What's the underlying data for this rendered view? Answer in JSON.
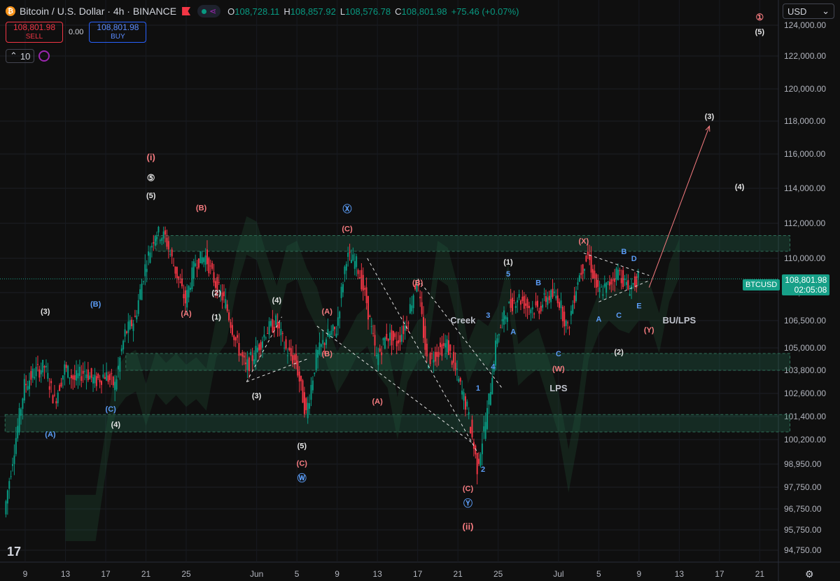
{
  "header": {
    "title": "Bitcoin / U.S. Dollar · 4h · BINANCE",
    "ohlc": [
      {
        "k": "O",
        "v": "108,728.11"
      },
      {
        "k": "H",
        "v": "108,857.92"
      },
      {
        "k": "L",
        "v": "108,576.78"
      },
      {
        "k": "C",
        "v": "108,801.98"
      }
    ],
    "change": "+75.46 (+0.07%)"
  },
  "trade": {
    "sell_price": "108,801.98",
    "sell_label": "SELL",
    "spread": "0.00",
    "buy_price": "108,801.98",
    "buy_label": "BUY"
  },
  "indicator": {
    "count": "10"
  },
  "currency": "USD",
  "price_tag": {
    "symbol": "BTCUSD",
    "price": "108,801.98",
    "countdown": "02:05:08"
  },
  "colors": {
    "up": "#089981",
    "down": "#f23645",
    "blue_label": "#5b9cf6",
    "red_label": "#f77c80",
    "accent": "#2962ff"
  },
  "chart_data": {
    "type": "candlestick",
    "price_axis": {
      "ticks": [
        124000,
        122000,
        120000,
        118000,
        116000,
        114000,
        112000,
        110000,
        108000,
        106500,
        105000,
        103800,
        102600,
        101400,
        100200,
        98950,
        97750,
        96750,
        95750,
        94750
      ],
      "tick_labels": [
        "124,000.00",
        "122,000.00",
        "120,000.00",
        "118,000.00",
        "116,000.00",
        "114,000.00",
        "112,000.00",
        "110,000.00",
        "108,000.00",
        "106,500.00",
        "105,000.00",
        "103,800.00",
        "102,600.00",
        "101,400.00",
        "100,200.00",
        "98,950.00",
        "97,750.00",
        "96,750.00",
        "95,750.00",
        "94,750.00"
      ]
    },
    "time_axis": {
      "ticks": [
        "May 9",
        "May 13",
        "May 17",
        "May 21",
        "May 25",
        "Jun",
        "Jun 5",
        "Jun 9",
        "Jun 13",
        "Jun 17",
        "Jun 21",
        "Jun 25",
        "Jul",
        "Jul 5",
        "Jul 9",
        "Jul 13",
        "Jul 17",
        "Jul 21"
      ],
      "tick_labels": [
        "9",
        "13",
        "17",
        "21",
        "25",
        "Jun",
        "5",
        "9",
        "13",
        "17",
        "21",
        "25",
        "Jul",
        "5",
        "9",
        "13",
        "17",
        "21"
      ]
    },
    "price_path": [
      {
        "t": "May 7",
        "p": 96500
      },
      {
        "t": "May 8",
        "p": 99800
      },
      {
        "t": "May 9",
        "p": 103000
      },
      {
        "t": "May 10",
        "p": 103700
      },
      {
        "t": "May 11",
        "p": 104000
      },
      {
        "t": "May 12",
        "p": 102200
      },
      {
        "t": "May 13",
        "p": 103900
      },
      {
        "t": "May 14",
        "p": 103300
      },
      {
        "t": "May 15",
        "p": 103800
      },
      {
        "t": "May 16",
        "p": 103200
      },
      {
        "t": "May 17",
        "p": 103600
      },
      {
        "t": "May 18",
        "p": 103000
      },
      {
        "t": "May 19",
        "p": 105800
      },
      {
        "t": "May 20",
        "p": 106600
      },
      {
        "t": "May 21",
        "p": 109500
      },
      {
        "t": "May 22",
        "p": 111500
      },
      {
        "t": "May 23",
        "p": 111200
      },
      {
        "t": "May 24",
        "p": 109300
      },
      {
        "t": "May 25",
        "p": 107500
      },
      {
        "t": "May 26",
        "p": 109800
      },
      {
        "t": "May 27",
        "p": 110100
      },
      {
        "t": "May 28",
        "p": 108500
      },
      {
        "t": "May 29",
        "p": 107400
      },
      {
        "t": "May 30",
        "p": 105400
      },
      {
        "t": "May 31",
        "p": 103900
      },
      {
        "t": "Jun 1",
        "p": 104800
      },
      {
        "t": "Jun 2",
        "p": 105900
      },
      {
        "t": "Jun 3",
        "p": 106400
      },
      {
        "t": "Jun 4",
        "p": 104900
      },
      {
        "t": "Jun 5",
        "p": 104200
      },
      {
        "t": "Jun 6",
        "p": 101500
      },
      {
        "t": "Jun 7",
        "p": 104500
      },
      {
        "t": "Jun 8",
        "p": 105600
      },
      {
        "t": "Jun 9",
        "p": 106000
      },
      {
        "t": "Jun 10",
        "p": 110100
      },
      {
        "t": "Jun 11",
        "p": 109700
      },
      {
        "t": "Jun 12",
        "p": 107500
      },
      {
        "t": "Jun 13",
        "p": 104400
      },
      {
        "t": "Jun 14",
        "p": 105700
      },
      {
        "t": "Jun 15",
        "p": 105300
      },
      {
        "t": "Jun 16",
        "p": 106400
      },
      {
        "t": "Jun 17",
        "p": 108800
      },
      {
        "t": "Jun 18",
        "p": 104300
      },
      {
        "t": "Jun 19",
        "p": 104800
      },
      {
        "t": "Jun 20",
        "p": 105200
      },
      {
        "t": "Jun 21",
        "p": 103500
      },
      {
        "t": "Jun 22",
        "p": 101800
      },
      {
        "t": "Jun 23",
        "p": 98800
      },
      {
        "t": "Jun 24",
        "p": 101600
      },
      {
        "t": "Jun 25",
        "p": 105700
      },
      {
        "t": "Jun 26",
        "p": 107100
      },
      {
        "t": "Jun 27",
        "p": 107800
      },
      {
        "t": "Jun 28",
        "p": 107300
      },
      {
        "t": "Jun 29",
        "p": 107100
      },
      {
        "t": "Jun 30",
        "p": 107800
      },
      {
        "t": "Jul 1",
        "p": 107800
      },
      {
        "t": "Jul 2",
        "p": 106000
      },
      {
        "t": "Jul 3",
        "p": 108800
      },
      {
        "t": "Jul 4",
        "p": 110200
      },
      {
        "t": "Jul 5",
        "p": 108000
      },
      {
        "t": "Jul 6",
        "p": 108400
      },
      {
        "t": "Jul 7",
        "p": 109300
      },
      {
        "t": "Jul 8",
        "p": 108200
      },
      {
        "t": "Jul 9",
        "p": 108800
      }
    ],
    "zones": [
      {
        "from": "May 22",
        "to": "Jul 24",
        "low": 110400,
        "high": 111300
      },
      {
        "from": "May 19",
        "to": "Jul 24",
        "low": 103800,
        "high": 104700
      },
      {
        "from": "May 7",
        "to": "Jul 24",
        "low": 100600,
        "high": 101500
      }
    ],
    "wave_labels": [
      {
        "text": "(i)",
        "t": "May 21.5",
        "p": 115800,
        "color": "red"
      },
      {
        "text": "⑤",
        "t": "May 21.5",
        "p": 114600,
        "color": "white"
      },
      {
        "text": "(5)",
        "t": "May 21.5",
        "p": 113600,
        "color": "white"
      },
      {
        "text": "(B)",
        "t": "May 26.5",
        "p": 112900,
        "color": "red"
      },
      {
        "text": "(2)",
        "t": "May 28",
        "p": 108000,
        "color": "white"
      },
      {
        "text": "(A)",
        "t": "May 25",
        "p": 106900,
        "color": "red"
      },
      {
        "text": "(1)",
        "t": "May 28",
        "p": 106700,
        "color": "white"
      },
      {
        "text": "(B)",
        "t": "May 16",
        "p": 107400,
        "color": "blue"
      },
      {
        "text": "(3)",
        "t": "May 11",
        "p": 107000,
        "color": "white"
      },
      {
        "text": "(C)",
        "t": "May 17.5",
        "p": 101800,
        "color": "blue"
      },
      {
        "text": "(4)",
        "t": "May 18",
        "p": 101000,
        "color": "white"
      },
      {
        "text": "(A)",
        "t": "May 11.5",
        "p": 100500,
        "color": "blue"
      },
      {
        "text": "(4)",
        "t": "Jun 3",
        "p": 107600,
        "color": "white"
      },
      {
        "text": "(3)",
        "t": "Jun 1",
        "p": 102500,
        "color": "white"
      },
      {
        "text": "(5)",
        "t": "Jun 5.5",
        "p": 99900,
        "color": "white"
      },
      {
        "text": "(C)",
        "t": "Jun 5.5",
        "p": 99000,
        "color": "red"
      },
      {
        "text": "Ⓦ",
        "t": "Jun 5.5",
        "p": 98200,
        "color": "blue"
      },
      {
        "text": "Ⓧ",
        "t": "Jun 10",
        "p": 112800,
        "color": "blue"
      },
      {
        "text": "(C)",
        "t": "Jun 10",
        "p": 111700,
        "color": "red"
      },
      {
        "text": "(A)",
        "t": "Jun 8",
        "p": 107000,
        "color": "red"
      },
      {
        "text": "(B)",
        "t": "Jun 8",
        "p": 104700,
        "color": "red"
      },
      {
        "text": "(B)",
        "t": "Jun 17",
        "p": 108600,
        "color": "red"
      },
      {
        "text": "(A)",
        "t": "Jun 13",
        "p": 102200,
        "color": "red"
      },
      {
        "text": "Creek",
        "t": "Jun 21.5",
        "p": 106500,
        "color": "gray"
      },
      {
        "text": "3",
        "t": "Jun 24",
        "p": 106800,
        "color": "blue"
      },
      {
        "text": "4",
        "t": "Jun 24.5",
        "p": 104000,
        "color": "blue"
      },
      {
        "text": "1",
        "t": "Jun 23",
        "p": 102900,
        "color": "blue"
      },
      {
        "text": "2",
        "t": "Jun 23.5",
        "p": 98700,
        "color": "blue"
      },
      {
        "text": "(C)",
        "t": "Jun 22",
        "p": 97700,
        "color": "red"
      },
      {
        "text": "Ⓨ",
        "t": "Jun 22",
        "p": 97000,
        "color": "blue"
      },
      {
        "text": "(ii)",
        "t": "Jun 22",
        "p": 95900,
        "color": "red"
      },
      {
        "text": "(1)",
        "t": "Jun 26",
        "p": 109800,
        "color": "white"
      },
      {
        "text": "5",
        "t": "Jun 26",
        "p": 109100,
        "color": "blue"
      },
      {
        "text": "B",
        "t": "Jun 29",
        "p": 108600,
        "color": "blue"
      },
      {
        "text": "A",
        "t": "Jun 26.5",
        "p": 105900,
        "color": "blue"
      },
      {
        "text": "C",
        "t": "Jul 1",
        "p": 104700,
        "color": "blue"
      },
      {
        "text": "(W)",
        "t": "Jul 1",
        "p": 103900,
        "color": "red"
      },
      {
        "text": "LPS",
        "t": "Jul 1",
        "p": 102850,
        "color": "gray"
      },
      {
        "text": "(X)",
        "t": "Jul 3.5",
        "p": 111000,
        "color": "red"
      },
      {
        "text": "B",
        "t": "Jul 7.5",
        "p": 110400,
        "color": "blue"
      },
      {
        "text": "D",
        "t": "Jul 8.5",
        "p": 110000,
        "color": "blue"
      },
      {
        "text": "A",
        "t": "Jul 5",
        "p": 106600,
        "color": "blue"
      },
      {
        "text": "C",
        "t": "Jul 7",
        "p": 106800,
        "color": "blue"
      },
      {
        "text": "E",
        "t": "Jul 9",
        "p": 107300,
        "color": "blue"
      },
      {
        "text": "(Y)",
        "t": "Jul 10",
        "p": 106000,
        "color": "red"
      },
      {
        "text": "BU/LPS",
        "t": "Jul 13",
        "p": 106500,
        "color": "gray"
      },
      {
        "text": "(2)",
        "t": "Jul 7",
        "p": 104800,
        "color": "white"
      },
      {
        "text": "(3)",
        "t": "Jul 16",
        "p": 118300,
        "color": "white"
      },
      {
        "text": "(4)",
        "t": "Jul 19",
        "p": 114100,
        "color": "white"
      },
      {
        "text": "①",
        "t": "Jul 21",
        "p": 124500,
        "color": "red"
      },
      {
        "text": "(5)",
        "t": "Jul 21",
        "p": 123600,
        "color": "white"
      }
    ],
    "trendlines": [
      {
        "from": {
          "t": "Jun 12",
          "p": 110000
        },
        "to": {
          "t": "Jun 23",
          "p": 99500
        }
      },
      {
        "from": {
          "t": "Jun 17",
          "p": 108800
        },
        "to": {
          "t": "Jun 25.5",
          "p": 102800
        }
      },
      {
        "from": {
          "t": "Jun 7",
          "p": 106200
        },
        "to": {
          "t": "Jun 22.5",
          "p": 100000
        }
      },
      {
        "from": {
          "t": "May 31",
          "p": 103200
        },
        "to": {
          "t": "Jun 3.5",
          "p": 106700
        }
      },
      {
        "from": {
          "t": "May 31",
          "p": 103200
        },
        "to": {
          "t": "Jun 6",
          "p": 104400
        }
      },
      {
        "from": {
          "t": "Jul 3.5",
          "p": 110300
        },
        "to": {
          "t": "Jul 10",
          "p": 109000
        }
      },
      {
        "from": {
          "t": "Jul 5",
          "p": 107500
        },
        "to": {
          "t": "Jul 10",
          "p": 108700
        }
      }
    ],
    "projection": [
      {
        "t": "Jul 10",
        "p": 108300
      },
      {
        "t": "Jul 16",
        "p": 117700
      }
    ],
    "last_price": 108801.98
  }
}
